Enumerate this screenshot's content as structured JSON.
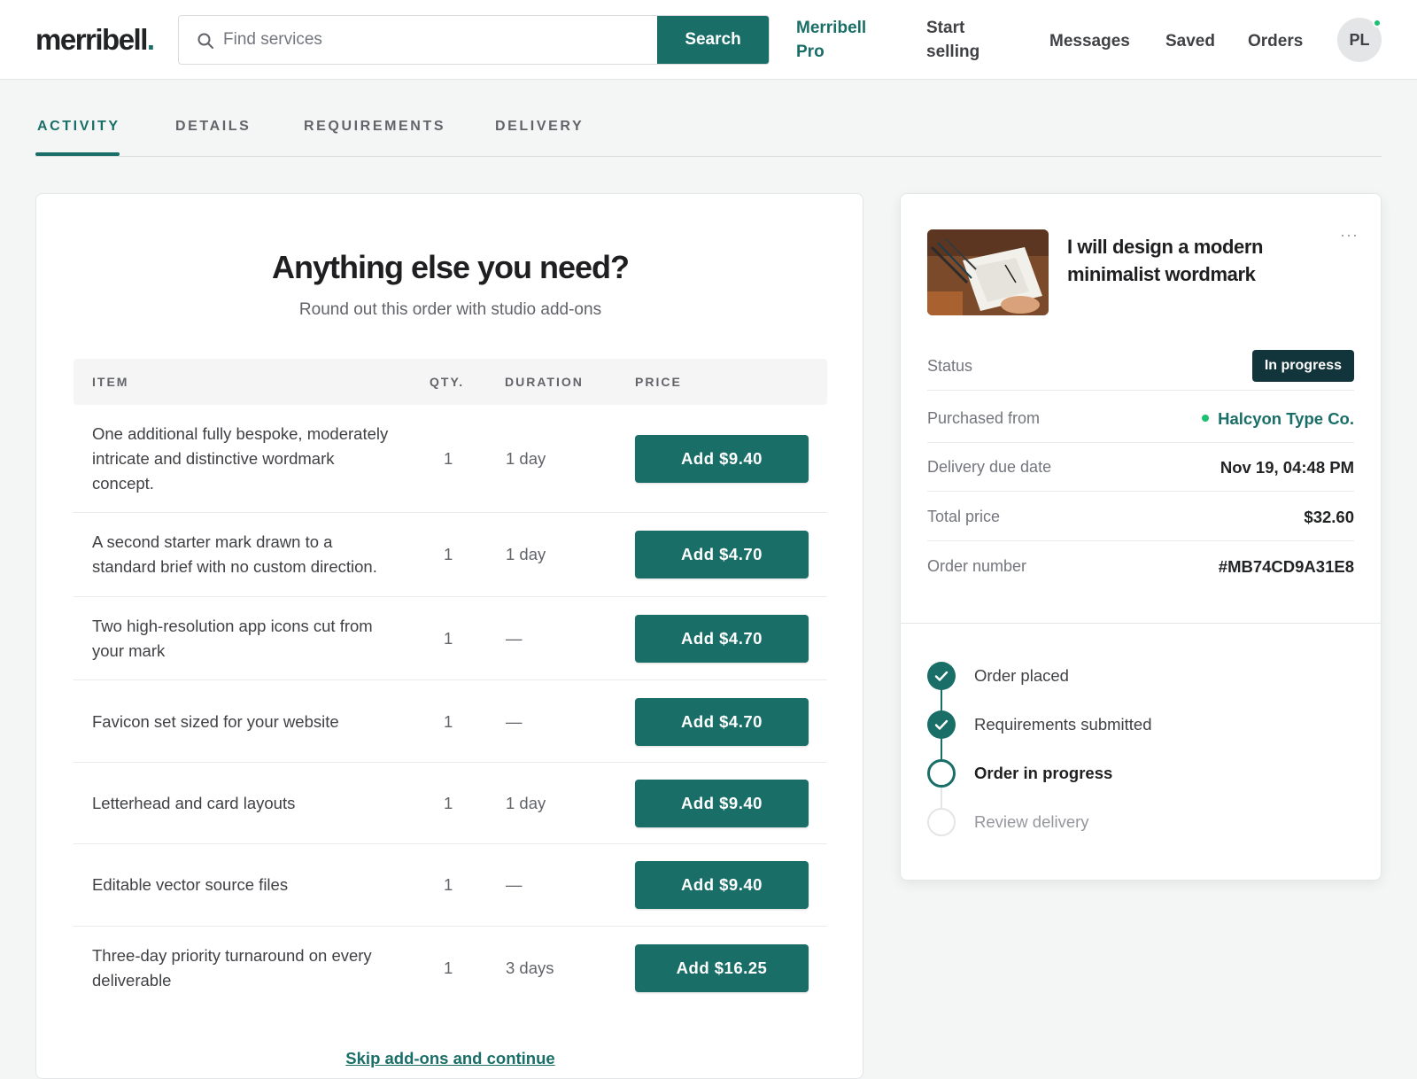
{
  "header": {
    "logo_text": "merribell",
    "logo_dot": ".",
    "search_placeholder": "Find services",
    "search_button": "Search",
    "nav": {
      "pro": "Merribell Pro",
      "sell": "Start selling",
      "messages": "Messages",
      "saved": "Saved",
      "orders": "Orders"
    },
    "avatar_initials": "PL"
  },
  "tabs": [
    {
      "label": "ACTIVITY",
      "active": true
    },
    {
      "label": "DETAILS",
      "active": false
    },
    {
      "label": "REQUIREMENTS",
      "active": false
    },
    {
      "label": "DELIVERY",
      "active": false
    }
  ],
  "addons": {
    "title": "Anything else you need?",
    "subtitle": "Round out this order with studio add-ons",
    "columns": {
      "item": "ITEM",
      "qty": "QTY.",
      "duration": "DURATION",
      "price": "PRICE"
    },
    "rows": [
      {
        "item": "One additional fully bespoke, moderately intricate and distinctive wordmark concept.",
        "qty": "1",
        "duration": "1 day",
        "button": "Add $9.40"
      },
      {
        "item": "A second starter mark drawn to a standard brief with no custom direction.",
        "qty": "1",
        "duration": "1 day",
        "button": "Add $4.70"
      },
      {
        "item": "Two high-resolution app icons cut from your mark",
        "qty": "1",
        "duration": "—",
        "button": "Add $4.70"
      },
      {
        "item": "Favicon set sized for your website",
        "qty": "1",
        "duration": "—",
        "button": "Add $4.70"
      },
      {
        "item": "Letterhead and card layouts",
        "qty": "1",
        "duration": "1 day",
        "button": "Add $9.40"
      },
      {
        "item": "Editable vector source files",
        "qty": "1",
        "duration": "—",
        "button": "Add $9.40"
      },
      {
        "item": "Three-day priority turnaround on every deliverable",
        "qty": "1",
        "duration": "3 days",
        "button": "Add $16.25"
      }
    ],
    "skip_link": "Skip add-ons and continue"
  },
  "order": {
    "gig_title": "I will design a modern minimalist wordmark",
    "more_icon": "···",
    "status_label": "Status",
    "status_value": "In progress",
    "seller_label": "Purchased from",
    "seller_value": "Halcyon Type Co.",
    "due_label": "Delivery due date",
    "due_value": "Nov 19, 04:48 PM",
    "total_label": "Total price",
    "total_value": "$32.60",
    "number_label": "Order number",
    "number_value": "#MB74CD9A31E8"
  },
  "timeline": [
    {
      "label": "Order placed",
      "state": "done"
    },
    {
      "label": "Requirements submitted",
      "state": "done"
    },
    {
      "label": "Order in progress",
      "state": "current"
    },
    {
      "label": "Review delivery",
      "state": "pending"
    }
  ],
  "colors": {
    "brand": "#1a6e68",
    "status_badge": "#12343b",
    "online": "#1dbf73"
  }
}
